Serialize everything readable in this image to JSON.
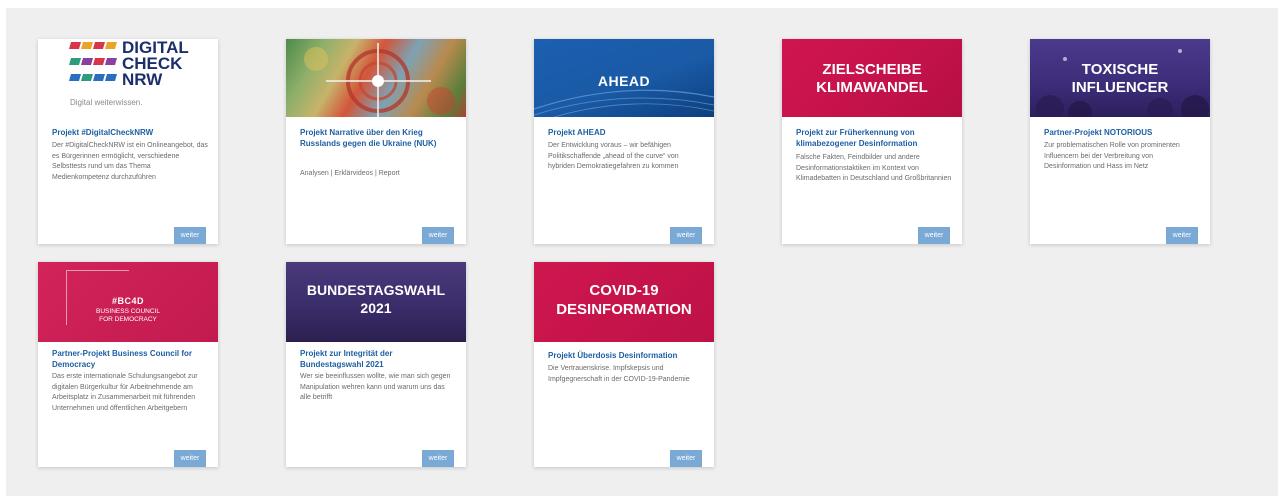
{
  "cards": [
    {
      "logo": {
        "line1": "DIGITAL",
        "line2": "CHECK",
        "line3": "NRW",
        "tagline": "Digital weiterwissen."
      },
      "title": "Projekt #DigitalCheckNRW",
      "desc": "Der #DigitalCheckNRW ist ein Onlineangebot, das es Bürgerinnen ermöglicht, verschiedene Selbsttests rund um das Thema Medienkompetenz durchzuführen",
      "button": "weiter"
    },
    {
      "title": "Projekt Narrative über den Krieg Russlands gegen die Ukraine (NUK)",
      "desc": "Analysen | Erklärvideos | Report",
      "button": "weiter"
    },
    {
      "image_text": "AHEAD",
      "title": "Projekt AHEAD",
      "desc": "Der Entwicklung voraus – wir befähigen Politikschaffende „ahead of the curve“ von hybriden Demokratiegefahren zu kommen",
      "button": "weiter"
    },
    {
      "image_text_1": "ZIELSCHEIBE",
      "image_text_2": "KLIMAWANDEL",
      "title": "Projekt zur Früherkennung von klimabezogener Desinformation",
      "desc": "Falsche Fakten, Feindbilder und andere Desinformationstaktiken im Kontext von Klimadebatten in Deutschland und Großbritannien",
      "button": "weiter"
    },
    {
      "image_text_1": "TOXISCHE",
      "image_text_2": "INFLUENCER",
      "title": "Partner-Projekt NOTORIOUS",
      "desc": "Zur problematischen Rolle von prominenten Influencern bei der Verbreitung von Desinformation und Hass im Netz",
      "button": "weiter"
    },
    {
      "image_text_1": "#BC4D",
      "image_text_2": "BUSINESS COUNCIL",
      "image_text_3": "FOR DEMOCRACY",
      "title": "Partner-Projekt Business Council for Democracy",
      "desc": "Das erste internationale Schulungsangebot zur digitalen Bürgerkultur für Arbeitnehmende am Arbeitsplatz in Zusammenarbeit mit führenden Unternehmen und öffentlichen Arbeitgebern",
      "button": "weiter"
    },
    {
      "image_text_1": "BUNDESTAGSWAHL",
      "image_text_2": "2021",
      "title": "Projekt zur Integrität der Bundestagswahl 2021",
      "desc": "Wer sie beeinflussen wollte, wie man sich gegen Manipulation wehren kann und warum uns das alle betrifft",
      "button": "weiter"
    },
    {
      "image_text_1": "COVID-19",
      "image_text_2": "DESINFORMATION",
      "title": "Projekt Überdosis Desinformation",
      "desc": "Die Vertrauenskrise. Impfskepsis und Impfgegnerschaft in der COVID-19-Pandemie",
      "button": "weiter"
    }
  ],
  "colors": {
    "title_blue": "#1d5fa3",
    "button_blue": "#7aa9d6",
    "magenta": "#c8164f",
    "purple": "#3b2a6e",
    "ahead_blue": "#1f5fa8",
    "background": "#efeff0"
  }
}
